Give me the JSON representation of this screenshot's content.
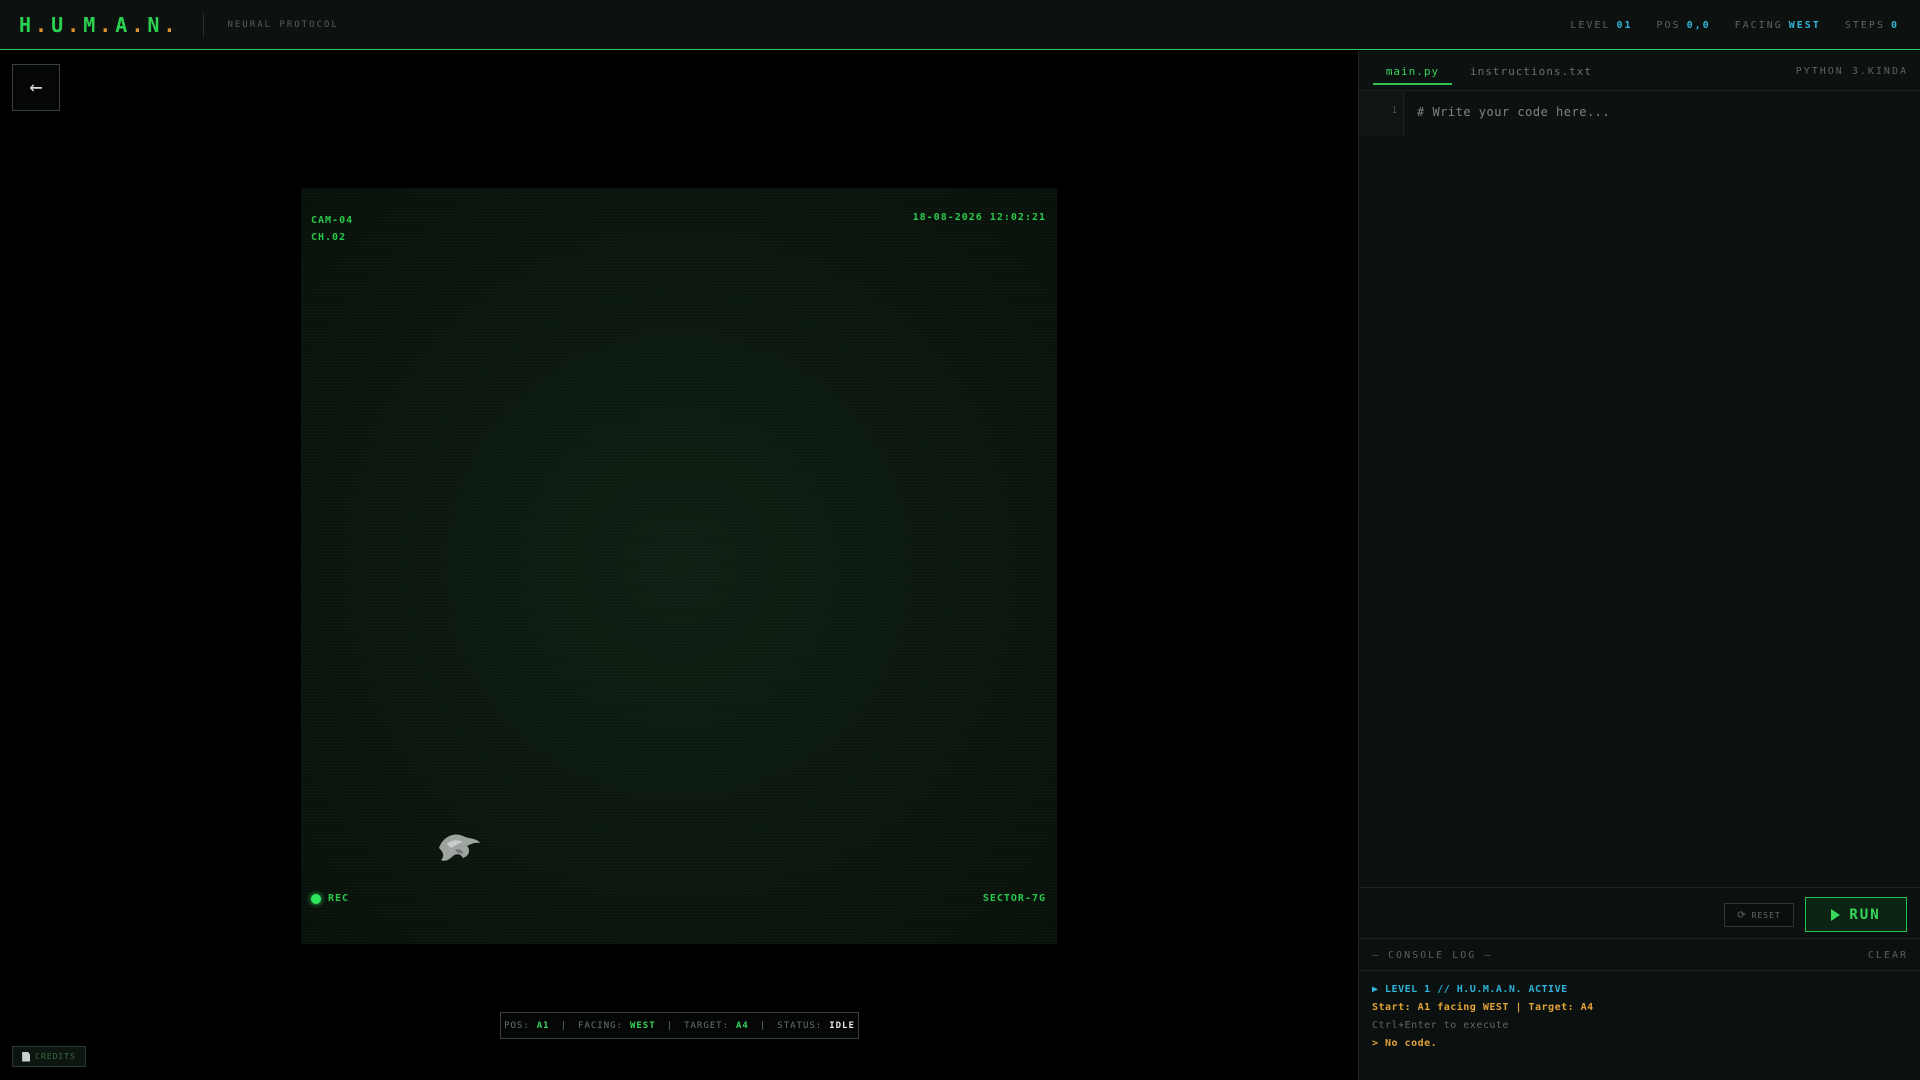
{
  "header": {
    "logo_letters": [
      "H",
      ".",
      "U",
      ".",
      "M",
      ".",
      "A",
      ".",
      "N",
      "."
    ],
    "subtitle": "NEURAL PROTOCOL",
    "stats": {
      "level_label": "LEVEL",
      "level_value": "01",
      "pos_label": "POS",
      "pos_value": "0,0",
      "facing_label": "FACING",
      "facing_value": "WEST",
      "steps_label": "STEPS",
      "steps_value": "0"
    }
  },
  "back_button": {
    "label": "←"
  },
  "camera": {
    "cam_id": "CAM-04",
    "channel": "CH.02",
    "timestamp": "18-08-2026 12:02:21",
    "rec_label": "REC",
    "sector": "SECTOR-7G"
  },
  "status_bar": {
    "pos_label": "POS:",
    "pos_value": "A1",
    "facing_label": "FACING:",
    "facing_value": "WEST",
    "target_label": "TARGET:",
    "target_value": "A4",
    "status_label": "STATUS:",
    "status_value": "IDLE",
    "separator": "|"
  },
  "credits": {
    "label": "CREDITS"
  },
  "editor": {
    "tabs": [
      {
        "label": "main.py",
        "active": true
      },
      {
        "label": "instructions.txt",
        "active": false
      }
    ],
    "language": "PYTHON 3.KINDA",
    "line_number": "1",
    "placeholder": "# Write your code here..."
  },
  "actions": {
    "reset_label": "RESET",
    "run_label": "RUN"
  },
  "console": {
    "title": "— CONSOLE LOG —",
    "clear_label": "CLEAR",
    "lines": [
      "▶ LEVEL 1 // H.U.M.A.N. ACTIVE",
      "Start: A1 facing WEST | Target: A4",
      "Ctrl+Enter to execute",
      "> No code."
    ]
  },
  "colors": {
    "accent_green": "#29d14f",
    "logo_orange": "#e0922c",
    "stat_cyan": "#2fb6d6",
    "console_amber": "#e3a336"
  }
}
